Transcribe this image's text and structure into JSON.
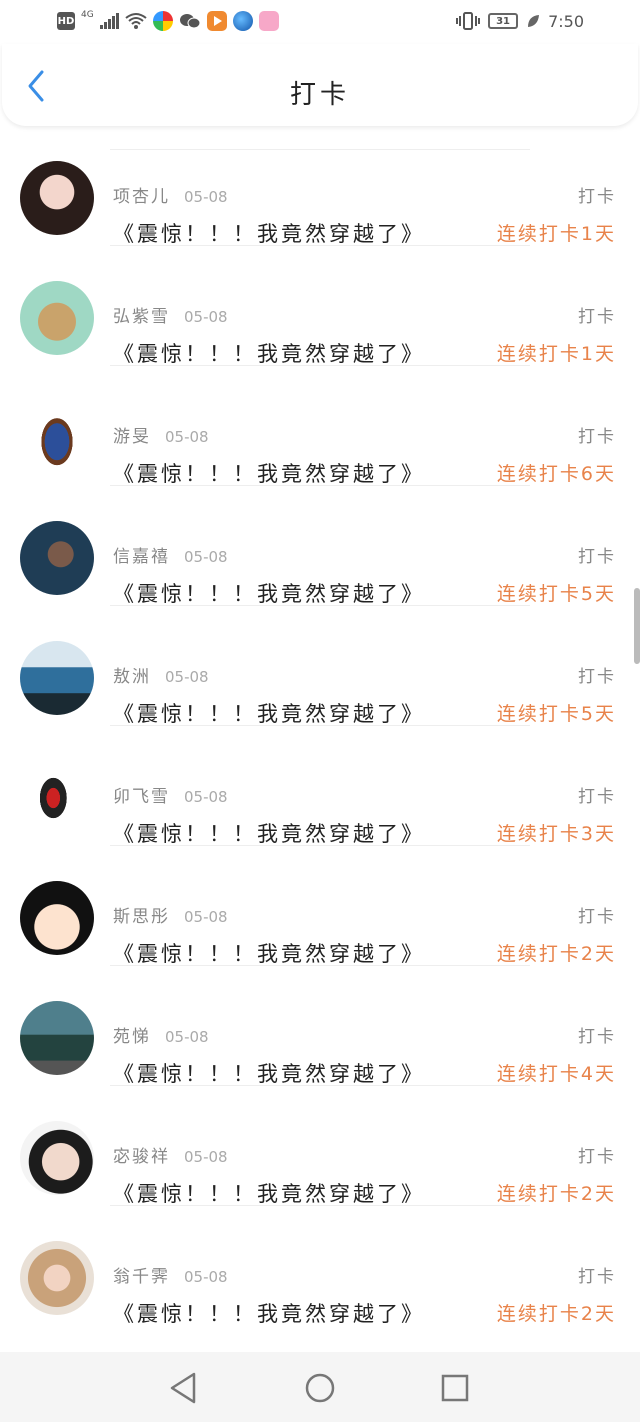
{
  "status_bar": {
    "hd": "HD",
    "network": "4G",
    "battery": "31",
    "time": "7:50"
  },
  "header": {
    "title": "打卡"
  },
  "items": [
    {
      "name": "项杏儿",
      "date": "05-08",
      "content": "《震惊！！！我竟然穿越了》",
      "action": "打卡",
      "streak": "连续打卡1天"
    },
    {
      "name": "弘紫雪",
      "date": "05-08",
      "content": "《震惊！！！我竟然穿越了》",
      "action": "打卡",
      "streak": "连续打卡1天"
    },
    {
      "name": "游旻",
      "date": "05-08",
      "content": "《震惊！！！我竟然穿越了》",
      "action": "打卡",
      "streak": "连续打卡6天"
    },
    {
      "name": "信嘉禧",
      "date": "05-08",
      "content": "《震惊！！！我竟然穿越了》",
      "action": "打卡",
      "streak": "连续打卡5天"
    },
    {
      "name": "敖洲",
      "date": "05-08",
      "content": "《震惊！！！我竟然穿越了》",
      "action": "打卡",
      "streak": "连续打卡5天"
    },
    {
      "name": "卯飞雪",
      "date": "05-08",
      "content": "《震惊！！！我竟然穿越了》",
      "action": "打卡",
      "streak": "连续打卡3天"
    },
    {
      "name": "斯思彤",
      "date": "05-08",
      "content": "《震惊！！！我竟然穿越了》",
      "action": "打卡",
      "streak": "连续打卡2天"
    },
    {
      "name": "苑悌",
      "date": "05-08",
      "content": "《震惊！！！我竟然穿越了》",
      "action": "打卡",
      "streak": "连续打卡4天"
    },
    {
      "name": "宓骏祥",
      "date": "05-08",
      "content": "《震惊！！！我竟然穿越了》",
      "action": "打卡",
      "streak": "连续打卡2天"
    },
    {
      "name": "翁千霁",
      "date": "05-08",
      "content": "《震惊！！！我竟然穿越了》",
      "action": "打卡",
      "streak": "连续打卡2天"
    }
  ],
  "colors": {
    "accent": "#e8834a",
    "back_icon": "#3a8ee6",
    "muted": "#888888"
  }
}
